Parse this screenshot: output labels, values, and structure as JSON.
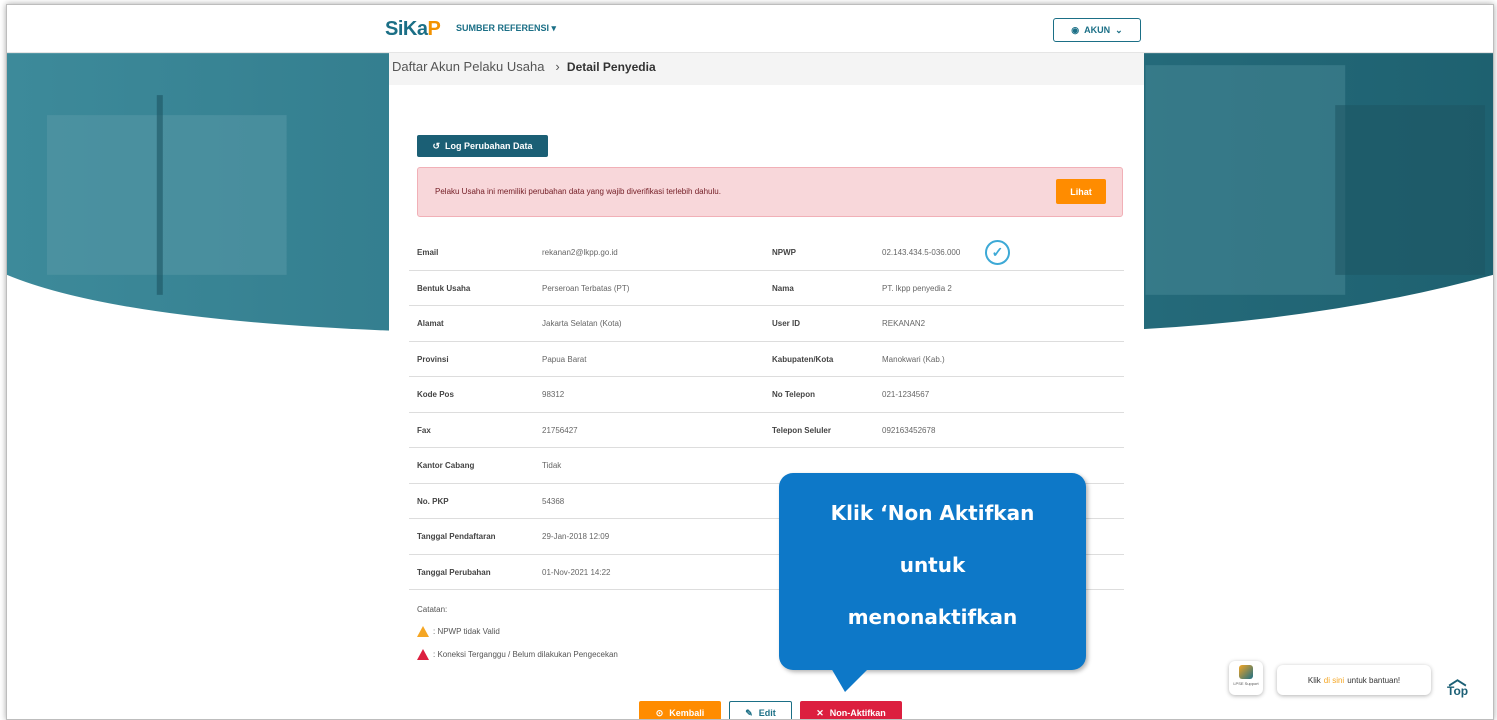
{
  "nav": {
    "logo_a": "SiKa",
    "logo_b": "P",
    "menu": "SUMBER REFERENSI ▾",
    "account": "AKUN"
  },
  "breadcrumb": {
    "parent": "Daftar Akun Pelaku Usaha",
    "separator": "›",
    "current": "Detail Penyedia"
  },
  "log_button": "Log Perubahan Data",
  "alert": {
    "message": "Pelaku Usaha ini memiliki perubahan data yang wajib diverifikasi terlebih dahulu.",
    "button": "Lihat"
  },
  "rows": [
    {
      "l1": "Email",
      "v1": "rekanan2@lkpp.go.id",
      "l2": "NPWP",
      "v2": "02.143.434.5-036.000"
    },
    {
      "l1": "Bentuk Usaha",
      "v1": "Perseroan Terbatas (PT)",
      "l2": "Nama",
      "v2": "PT. lkpp penyedia 2"
    },
    {
      "l1": "Alamat",
      "v1": "Jakarta Selatan (Kota)",
      "l2": "User ID",
      "v2": "REKANAN2"
    },
    {
      "l1": "Provinsi",
      "v1": "Papua Barat",
      "l2": "Kabupaten/Kota",
      "v2": "Manokwari (Kab.)"
    },
    {
      "l1": "Kode Pos",
      "v1": "98312",
      "l2": "No Telepon",
      "v2": "021-1234567"
    },
    {
      "l1": "Fax",
      "v1": "21756427",
      "l2": "Telepon Seluler",
      "v2": "092163452678"
    },
    {
      "l1": "Kantor Cabang",
      "v1": "Tidak",
      "l2": "",
      "v2": ""
    },
    {
      "l1": "No. PKP",
      "v1": "54368",
      "l2": "",
      "v2": ""
    },
    {
      "l1": "Tanggal Pendaftaran",
      "v1": "29-Jan-2018 12:09",
      "l2": "",
      "v2": ""
    },
    {
      "l1": "Tanggal Perubahan",
      "v1": "01-Nov-2021 14:22",
      "l2": "",
      "v2": ""
    }
  ],
  "notes": {
    "title": "Catatan:",
    "warn1": ": NPWP tidak Valid",
    "warn2": ": Koneksi Terganggu / Belum dilakukan Pengecekan"
  },
  "buttons": {
    "kembali": "Kembali",
    "edit": "Edit",
    "nonaktif": "Non-Aktifkan"
  },
  "callout": {
    "line1": "Klik ‘Non Aktifkan",
    "line2": "untuk",
    "line3": "menonaktifkan"
  },
  "support": {
    "label": "LPSE Support",
    "pre": "Klik",
    "link": "di sini",
    "post": "untuk bantuan!"
  },
  "top": "Top",
  "colors": {
    "primary": "#1b5f75",
    "orange": "#ff8c00",
    "red": "#dc1f3f",
    "callout": "#0d78c8",
    "alert_bg": "#f8d7da"
  }
}
